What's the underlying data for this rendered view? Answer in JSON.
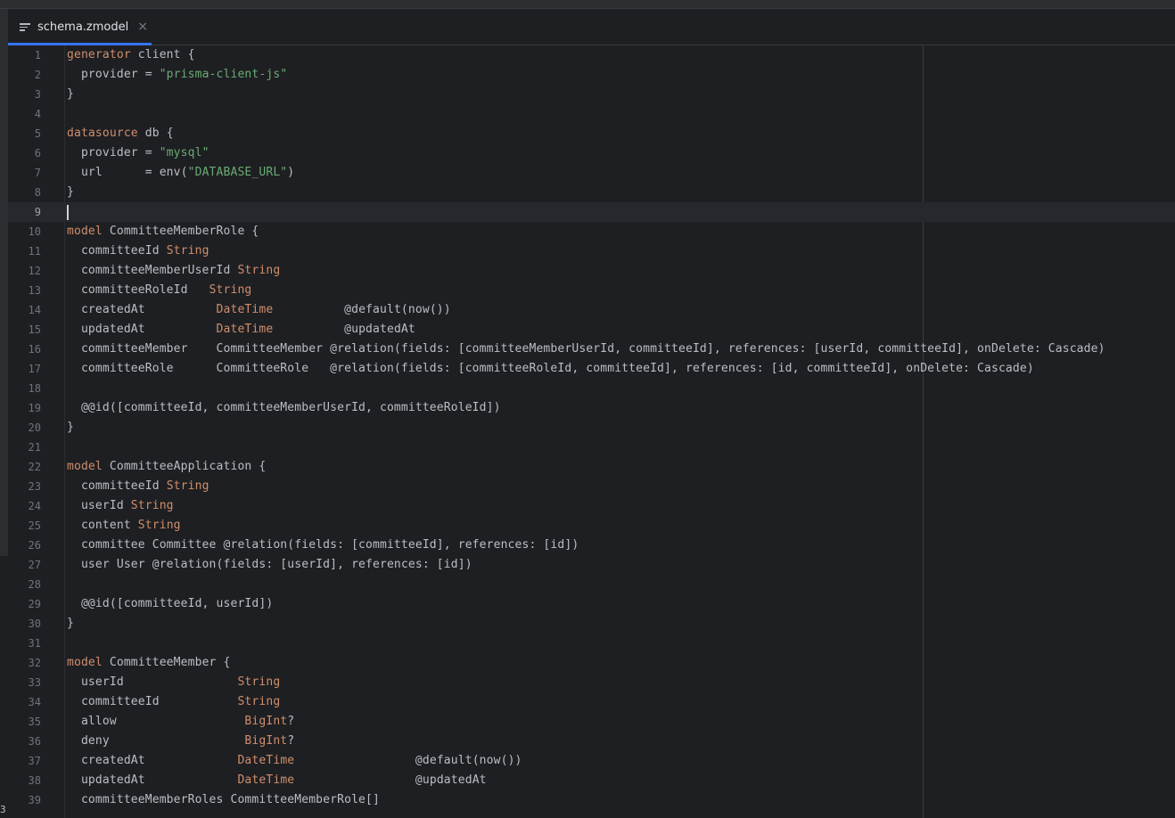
{
  "tab": {
    "title": "schema.zmodel",
    "close": "×"
  },
  "editor": {
    "current_line": 9,
    "lines": [
      {
        "n": "1",
        "s": [
          [
            "k",
            "generator"
          ],
          [
            "p",
            " client {"
          ]
        ]
      },
      {
        "n": "2",
        "s": [
          [
            "p",
            "  provider = "
          ],
          [
            "s",
            "\"prisma-client-js\""
          ]
        ]
      },
      {
        "n": "3",
        "s": [
          [
            "p",
            "}"
          ]
        ]
      },
      {
        "n": "4",
        "s": []
      },
      {
        "n": "5",
        "s": [
          [
            "k",
            "datasource"
          ],
          [
            "p",
            " db {"
          ]
        ]
      },
      {
        "n": "6",
        "s": [
          [
            "p",
            "  provider = "
          ],
          [
            "s",
            "\"mysql\""
          ]
        ]
      },
      {
        "n": "7",
        "s": [
          [
            "p",
            "  url      = env("
          ],
          [
            "s",
            "\"DATABASE_URL\""
          ],
          [
            "p",
            ")"
          ]
        ]
      },
      {
        "n": "8",
        "s": [
          [
            "p",
            "}"
          ]
        ]
      },
      {
        "n": "9",
        "s": []
      },
      {
        "n": "10",
        "s": [
          [
            "k",
            "model"
          ],
          [
            "p",
            " CommitteeMemberRole {"
          ]
        ]
      },
      {
        "n": "11",
        "s": [
          [
            "p",
            "  committeeId "
          ],
          [
            "t",
            "String"
          ]
        ]
      },
      {
        "n": "12",
        "s": [
          [
            "p",
            "  committeeMemberUserId "
          ],
          [
            "t",
            "String"
          ]
        ]
      },
      {
        "n": "13",
        "s": [
          [
            "p",
            "  committeeRoleId   "
          ],
          [
            "t",
            "String"
          ]
        ]
      },
      {
        "n": "14",
        "s": [
          [
            "p",
            "  createdAt          "
          ],
          [
            "t",
            "DateTime"
          ],
          [
            "p",
            "          @default(now())"
          ]
        ]
      },
      {
        "n": "15",
        "s": [
          [
            "p",
            "  updatedAt          "
          ],
          [
            "t",
            "DateTime"
          ],
          [
            "p",
            "          @updatedAt"
          ]
        ]
      },
      {
        "n": "16",
        "s": [
          [
            "p",
            "  committeeMember    CommitteeMember @relation(fields: [committeeMemberUserId, committeeId], references: [userId, committeeId], onDelete: Cascade)"
          ]
        ]
      },
      {
        "n": "17",
        "s": [
          [
            "p",
            "  committeeRole      CommitteeRole   @relation(fields: [committeeRoleId, committeeId], references: [id, committeeId], onDelete: Cascade)"
          ]
        ]
      },
      {
        "n": "18",
        "s": []
      },
      {
        "n": "19",
        "s": [
          [
            "p",
            "  @@id([committeeId, committeeMemberUserId, committeeRoleId])"
          ]
        ]
      },
      {
        "n": "20",
        "s": [
          [
            "p",
            "}"
          ]
        ]
      },
      {
        "n": "21",
        "s": []
      },
      {
        "n": "22",
        "s": [
          [
            "k",
            "model"
          ],
          [
            "p",
            " CommitteeApplication {"
          ]
        ]
      },
      {
        "n": "23",
        "s": [
          [
            "p",
            "  committeeId "
          ],
          [
            "t",
            "String"
          ]
        ]
      },
      {
        "n": "24",
        "s": [
          [
            "p",
            "  userId "
          ],
          [
            "t",
            "String"
          ]
        ]
      },
      {
        "n": "25",
        "s": [
          [
            "p",
            "  content "
          ],
          [
            "t",
            "String"
          ]
        ]
      },
      {
        "n": "26",
        "s": [
          [
            "p",
            "  committee Committee @relation(fields: [committeeId], references: [id])"
          ]
        ]
      },
      {
        "n": "27",
        "s": [
          [
            "p",
            "  user User @relation(fields: [userId], references: [id])"
          ]
        ]
      },
      {
        "n": "28",
        "s": []
      },
      {
        "n": "29",
        "s": [
          [
            "p",
            "  @@id([committeeId, userId])"
          ]
        ]
      },
      {
        "n": "30",
        "s": [
          [
            "p",
            "}"
          ]
        ]
      },
      {
        "n": "31",
        "s": []
      },
      {
        "n": "32",
        "s": [
          [
            "k",
            "model"
          ],
          [
            "p",
            " CommitteeMember {"
          ]
        ]
      },
      {
        "n": "33",
        "s": [
          [
            "p",
            "  userId                "
          ],
          [
            "t",
            "String"
          ]
        ]
      },
      {
        "n": "34",
        "s": [
          [
            "p",
            "  committeeId           "
          ],
          [
            "t",
            "String"
          ]
        ]
      },
      {
        "n": "35",
        "s": [
          [
            "p",
            "  allow                  "
          ],
          [
            "t",
            "BigInt"
          ],
          [
            "p",
            "?"
          ]
        ]
      },
      {
        "n": "36",
        "s": [
          [
            "p",
            "  deny                   "
          ],
          [
            "t",
            "BigInt"
          ],
          [
            "p",
            "?"
          ]
        ]
      },
      {
        "n": "37",
        "s": [
          [
            "p",
            "  createdAt             "
          ],
          [
            "t",
            "DateTime"
          ],
          [
            "p",
            "                 @default(now())"
          ]
        ]
      },
      {
        "n": "38",
        "s": [
          [
            "p",
            "  updatedAt             "
          ],
          [
            "t",
            "DateTime"
          ],
          [
            "p",
            "                 @updatedAt"
          ]
        ]
      },
      {
        "n": "39",
        "s": [
          [
            "p",
            "  committeeMemberRoles CommitteeMemberRole[]"
          ]
        ]
      }
    ]
  }
}
